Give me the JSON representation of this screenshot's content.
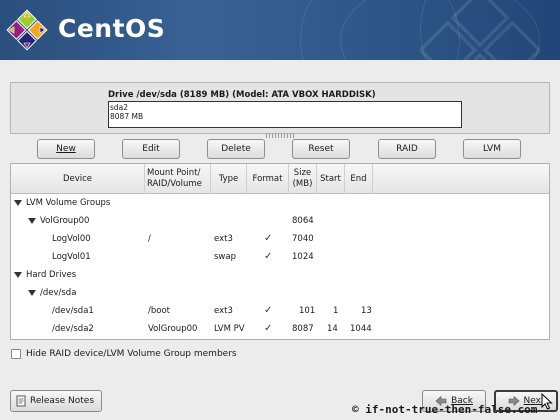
{
  "banner": {
    "logo_text": "CentOS"
  },
  "drive": {
    "title": "Drive /dev/sda (8189 MB) (Model: ATA VBOX HARDDISK)",
    "segment_name": "sda2",
    "segment_size": "8087 MB"
  },
  "buttons": {
    "new": "New",
    "edit": "Edit",
    "delete": "Delete",
    "reset": "Reset",
    "raid": "RAID",
    "lvm": "LVM"
  },
  "columns": {
    "device": "Device",
    "mount_a": "Mount Point/",
    "mount_b": "RAID/Volume",
    "type": "Type",
    "format": "Format",
    "size_a": "Size",
    "size_b": "(MB)",
    "start": "Start",
    "end": "End"
  },
  "rows": [
    {
      "device": "LVM Volume Groups",
      "mount": "",
      "type": "",
      "format": "",
      "size": "",
      "start": "",
      "end": ""
    },
    {
      "device": "VolGroup00",
      "mount": "",
      "type": "",
      "format": "",
      "size": "8064",
      "start": "",
      "end": ""
    },
    {
      "device": "LogVol00",
      "mount": "/",
      "type": "ext3",
      "format": "✓",
      "size": "7040",
      "start": "",
      "end": ""
    },
    {
      "device": "LogVol01",
      "mount": "",
      "type": "swap",
      "format": "✓",
      "size": "1024",
      "start": "",
      "end": ""
    },
    {
      "device": "Hard Drives",
      "mount": "",
      "type": "",
      "format": "",
      "size": "",
      "start": "",
      "end": ""
    },
    {
      "device": "/dev/sda",
      "mount": "",
      "type": "",
      "format": "",
      "size": "",
      "start": "",
      "end": ""
    },
    {
      "device": "/dev/sda1",
      "mount": "/boot",
      "type": "ext3",
      "format": "✓",
      "size": "101",
      "start": "1",
      "end": "13"
    },
    {
      "device": "/dev/sda2",
      "mount": "VolGroup00",
      "type": "LVM PV",
      "format": "✓",
      "size": "8087",
      "start": "14",
      "end": "1044"
    }
  ],
  "hide_members_label": "Hide RAID device/LVM Volume Group members",
  "hide_members_checked": false,
  "footer": {
    "release_notes": "Release Notes",
    "back": "Back",
    "next": "Next",
    "watermark": "© if-not-true-then-false.com"
  },
  "colors": {
    "banner": "#2d5687",
    "accent_next_border": "#3a3a3a"
  }
}
